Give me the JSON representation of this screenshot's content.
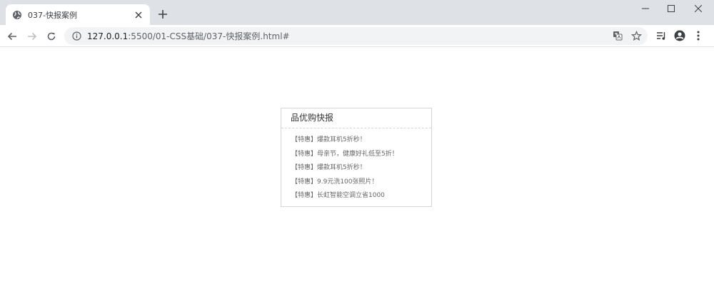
{
  "browser": {
    "tab_title": "037-快报案例",
    "url_host": "127.0.0.1",
    "url_rest": ":5500/01-CSS基础/037-快报案例.html#"
  },
  "news": {
    "title": "品优购快报",
    "items": [
      "【特惠】爆款耳机5折秒！",
      "【特惠】母亲节，健康好礼低至5折！",
      "【特惠】爆款耳机5折秒！",
      "【特惠】9.9元洗100张照片！",
      "【特惠】长虹智能空调立省1000"
    ]
  }
}
